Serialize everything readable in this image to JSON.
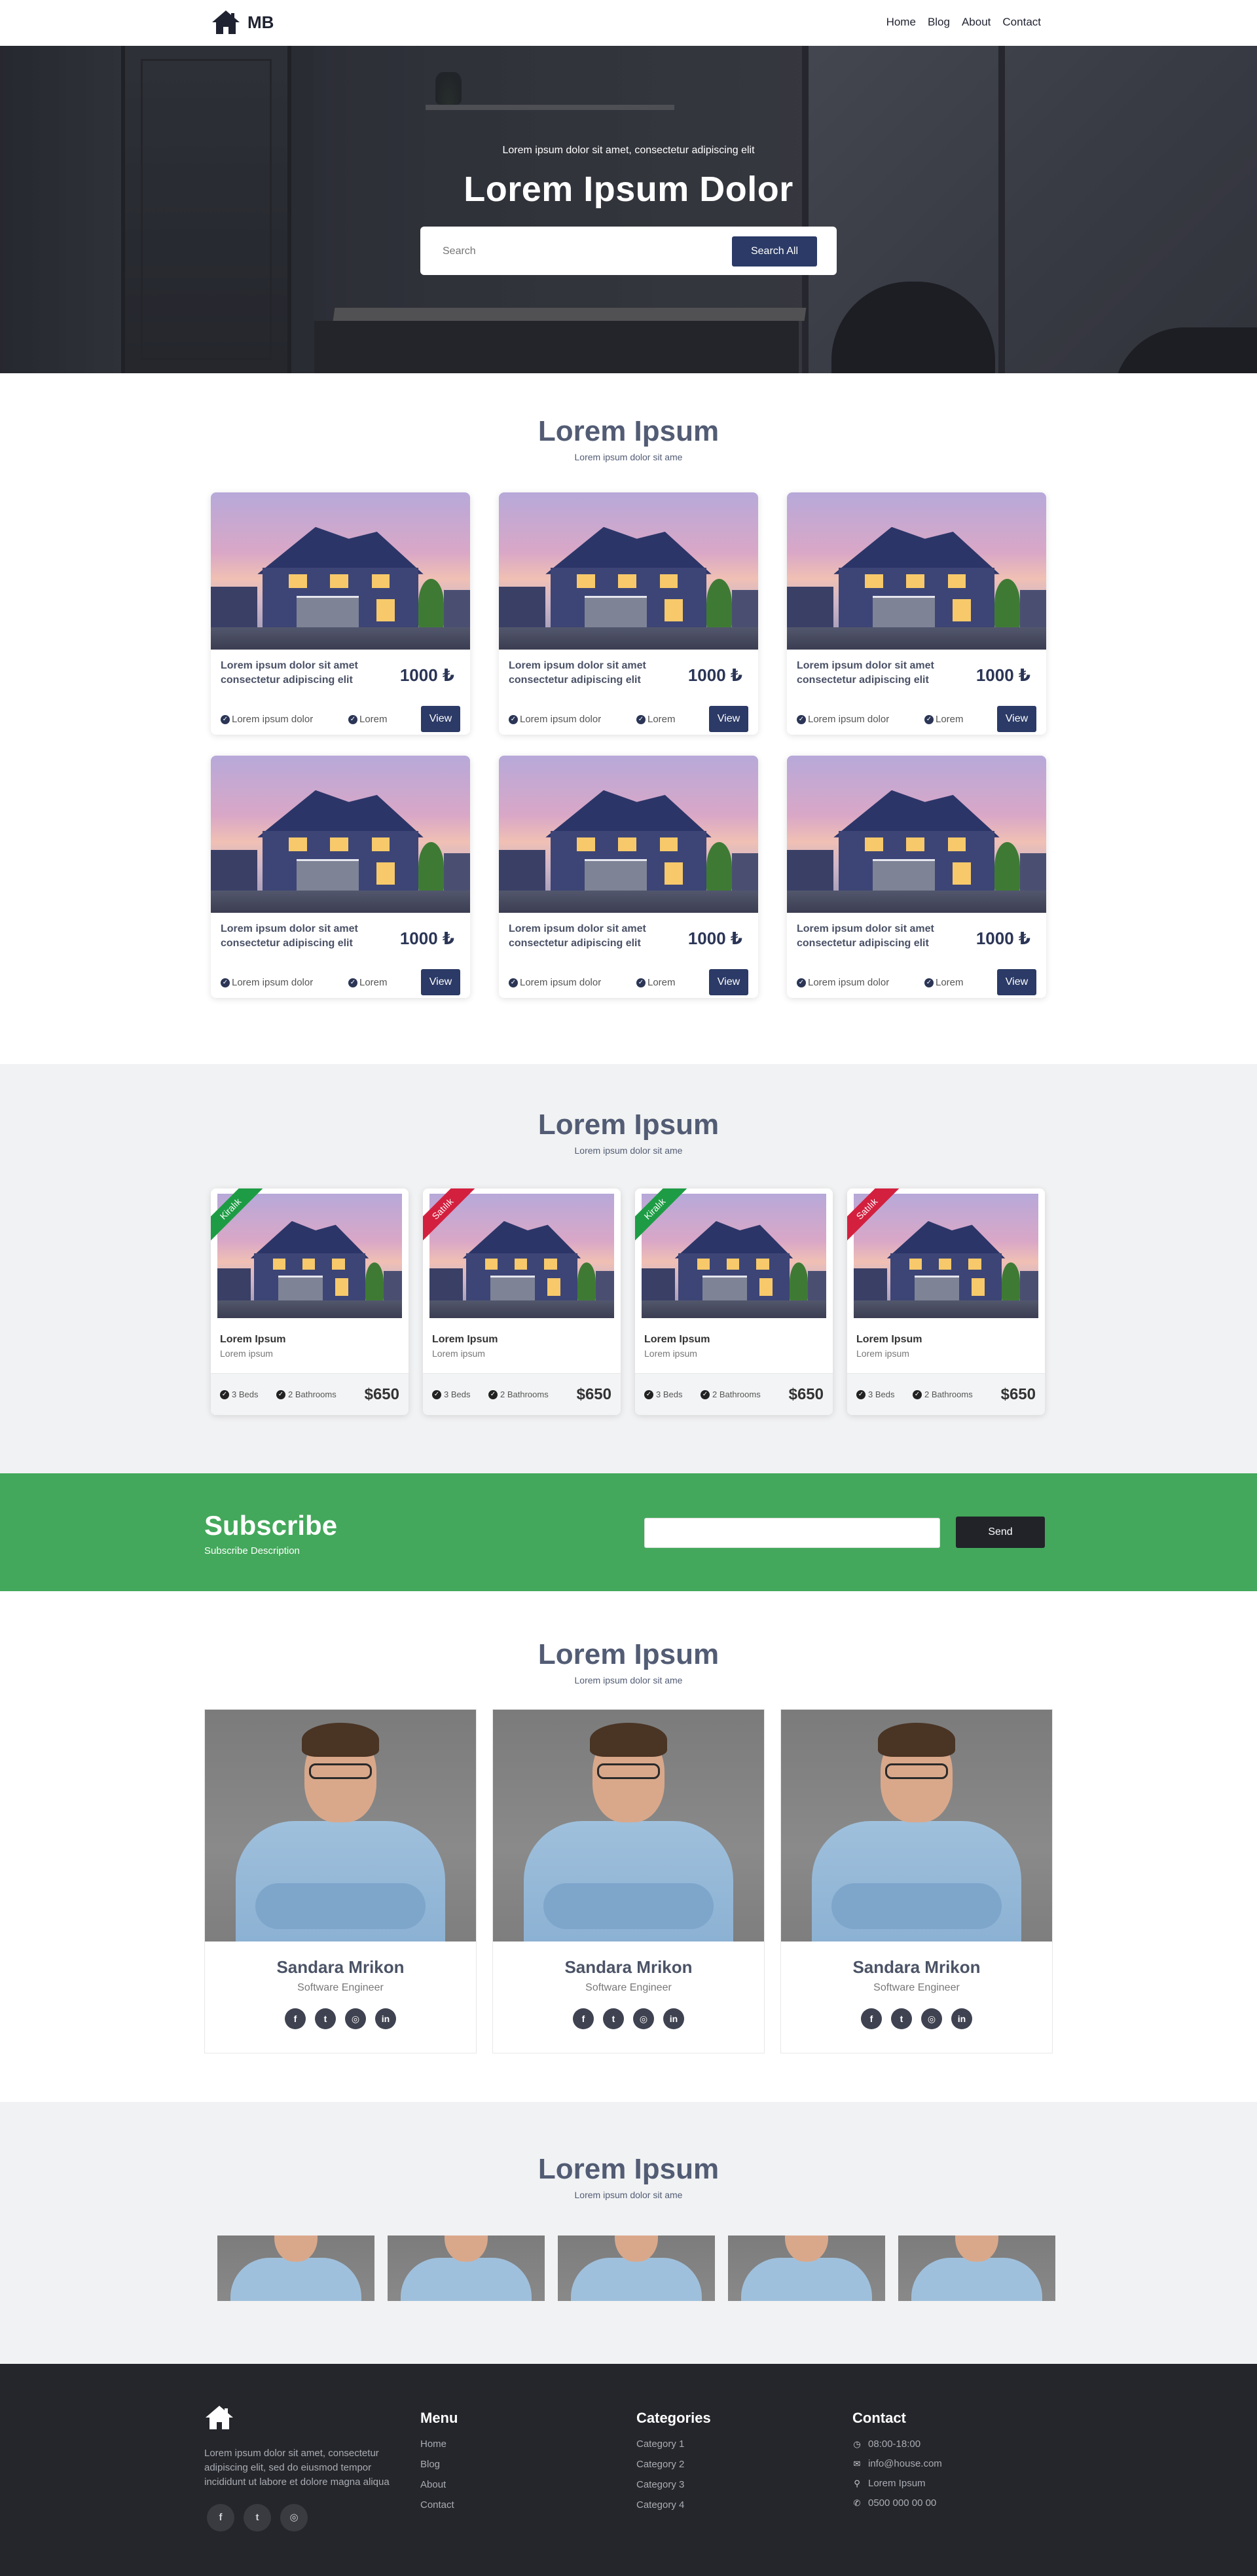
{
  "navbar": {
    "logo_text": "MB",
    "links": [
      "Home",
      "Blog",
      "About",
      "Contact"
    ]
  },
  "hero": {
    "subtitle": "Lorem ipsum dolor sit amet, consectetur adipiscing elit",
    "title": "Lorem Ipsum Dolor",
    "search_placeholder": "Search",
    "search_button": "Search All"
  },
  "listings": {
    "title": "Lorem Ipsum",
    "subtitle": "Lorem ipsum dolor sit ame",
    "cards": [
      {
        "title": "Lorem ipsum dolor sit amet consectetur adipiscing elit",
        "price": "1000 ₺",
        "feature1": "Lorem ipsum dolor",
        "feature2": "Lorem",
        "button": "View"
      },
      {
        "title": "Lorem ipsum dolor sit amet consectetur adipiscing elit",
        "price": "1000 ₺",
        "feature1": "Lorem ipsum dolor",
        "feature2": "Lorem",
        "button": "View"
      },
      {
        "title": "Lorem ipsum dolor sit amet consectetur adipiscing elit",
        "price": "1000 ₺",
        "feature1": "Lorem ipsum dolor",
        "feature2": "Lorem",
        "button": "View"
      },
      {
        "title": "Lorem ipsum dolor sit amet consectetur adipiscing elit",
        "price": "1000 ₺",
        "feature1": "Lorem ipsum dolor",
        "feature2": "Lorem",
        "button": "View"
      },
      {
        "title": "Lorem ipsum dolor sit amet consectetur adipiscing elit",
        "price": "1000 ₺",
        "feature1": "Lorem ipsum dolor",
        "feature2": "Lorem",
        "button": "View"
      },
      {
        "title": "Lorem ipsum dolor sit amet consectetur adipiscing elit",
        "price": "1000 ₺",
        "feature1": "Lorem ipsum dolor",
        "feature2": "Lorem",
        "button": "View"
      }
    ]
  },
  "listings2": {
    "title": "Lorem Ipsum",
    "subtitle": "Lorem ipsum dolor sit ame",
    "cards": [
      {
        "ribbon": "Kiralık",
        "ribbon_color": "#1e9c45",
        "title": "Lorem Ipsum",
        "subtitle": "Lorem ipsum",
        "beds": "3 Beds",
        "baths": "2 Bathrooms",
        "price": "$650"
      },
      {
        "ribbon": "Satılık",
        "ribbon_color": "#d3203f",
        "title": "Lorem Ipsum",
        "subtitle": "Lorem ipsum",
        "beds": "3 Beds",
        "baths": "2 Bathrooms",
        "price": "$650"
      },
      {
        "ribbon": "Kiralık",
        "ribbon_color": "#1e9c45",
        "title": "Lorem Ipsum",
        "subtitle": "Lorem ipsum",
        "beds": "3 Beds",
        "baths": "2 Bathrooms",
        "price": "$650"
      },
      {
        "ribbon": "Satılık",
        "ribbon_color": "#d3203f",
        "title": "Lorem Ipsum",
        "subtitle": "Lorem ipsum",
        "beds": "3 Beds",
        "baths": "2 Bathrooms",
        "price": "$650"
      }
    ]
  },
  "subscribe": {
    "title": "Subscribe",
    "description": "Subscribe Description",
    "button": "Send",
    "background": "#43a85b"
  },
  "team": {
    "title": "Lorem Ipsum",
    "subtitle": "Lorem ipsum dolor sit ame",
    "members": [
      {
        "name": "Sandara Mrikon",
        "role": "Software Engineer",
        "social": [
          "facebook-icon",
          "twitter-icon",
          "instagram-icon",
          "linkedin-icon"
        ]
      },
      {
        "name": "Sandara Mrikon",
        "role": "Software Engineer",
        "social": [
          "facebook-icon",
          "twitter-icon",
          "instagram-icon",
          "linkedin-icon"
        ]
      },
      {
        "name": "Sandara Mrikon",
        "role": "Software Engineer",
        "social": [
          "facebook-icon",
          "twitter-icon",
          "instagram-icon",
          "linkedin-icon"
        ]
      }
    ]
  },
  "gallery": {
    "title": "Lorem Ipsum",
    "subtitle": "Lorem ipsum dolor sit ame"
  },
  "footer": {
    "about": "Lorem ipsum dolor sit amet, consectetur adipiscing elit, sed do eiusmod tempor incididunt ut labore et dolore magna aliqua",
    "social": [
      "facebook-icon",
      "twitter-icon",
      "instagram-icon"
    ],
    "menu": {
      "title": "Menu",
      "links": [
        "Home",
        "Blog",
        "About",
        "Contact"
      ]
    },
    "categories": {
      "title": "Categories",
      "links": [
        "Category 1",
        "Category 2",
        "Category 3",
        "Category 4"
      ]
    },
    "contact": {
      "title": "Contact",
      "hours": "08:00-18:00",
      "email": "info@house.com",
      "location": "Lorem Ipsum",
      "phone": "0500 000 00 00"
    }
  }
}
